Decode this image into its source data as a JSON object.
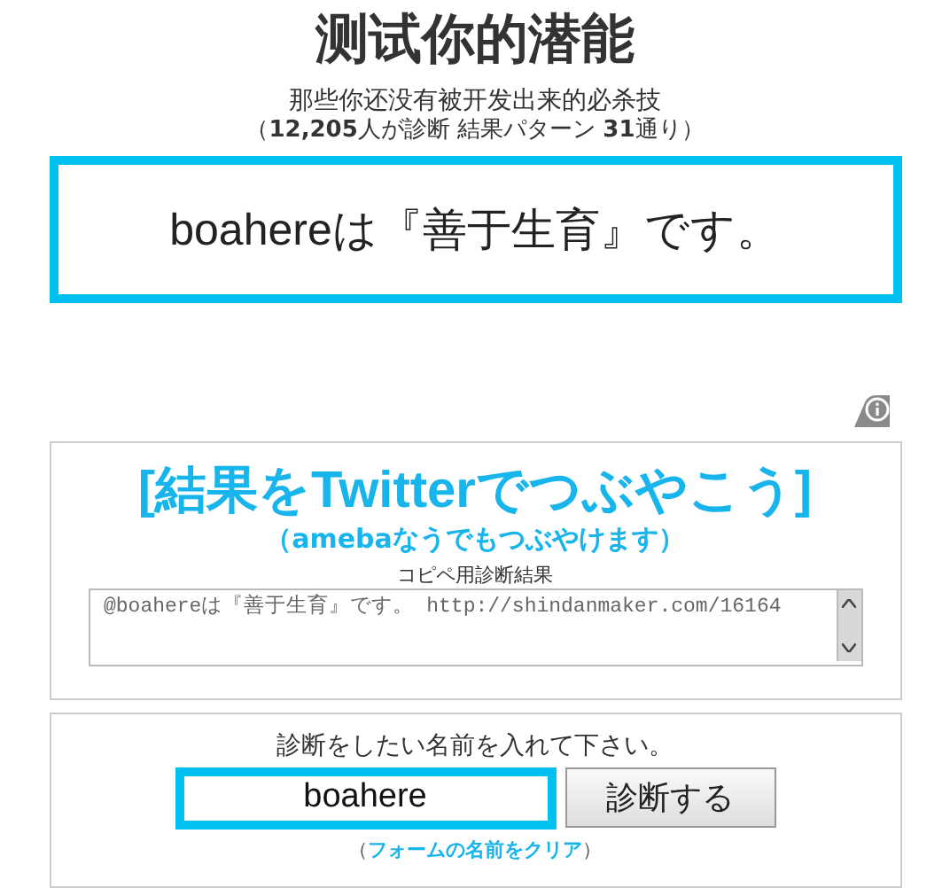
{
  "header": {
    "title": "测试你的潜能",
    "subtitle": "那些你还没有被开发出来的必杀技",
    "stats": "（**12,205**人が診断 結果パターン **31**通り）"
  },
  "result": {
    "text": "boahereは『善于生育』です。"
  },
  "share": {
    "twitter_link": "[結果をTwitterでつぶやこう]",
    "ameba_link": "（amebaなうでもつぶやけます）",
    "copy_label": "コピペ用診断結果",
    "copy_text": "@boahereは『善于生育』です。 http://shindanmaker.com/16164"
  },
  "form": {
    "prompt": "診断をしたい名前を入れて下さい。",
    "name_value": "boahere",
    "submit": "診断する",
    "clear_open": "（",
    "clear_link": "フォームの名前をクリア",
    "clear_close": "）"
  }
}
